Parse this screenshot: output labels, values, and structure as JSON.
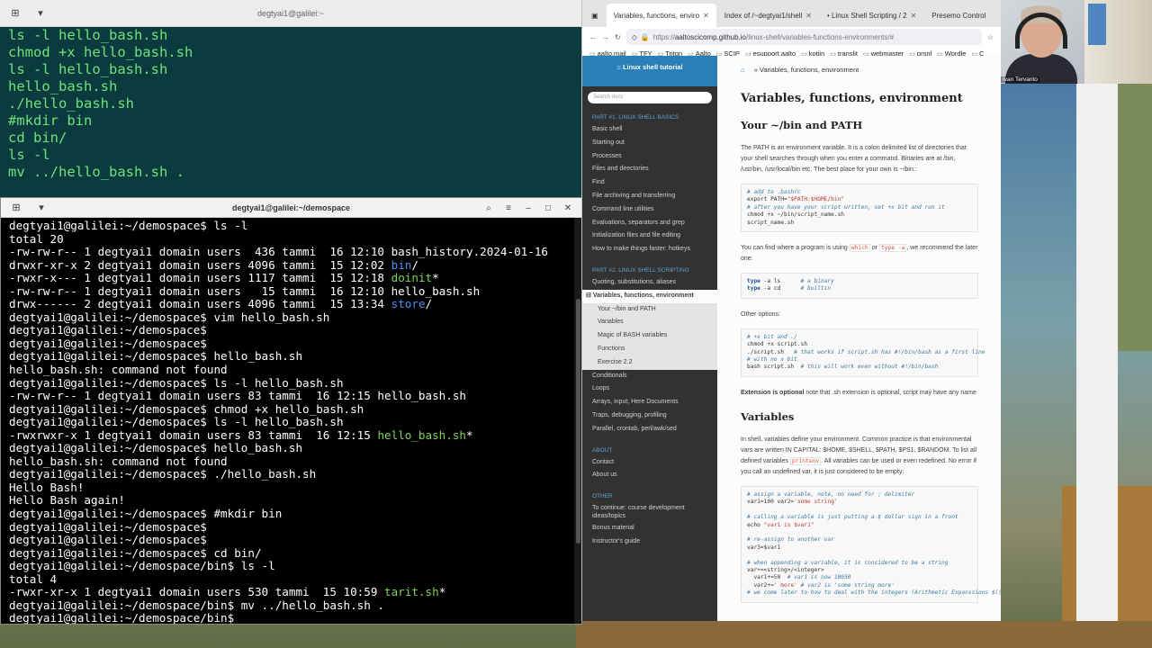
{
  "terminal_top": {
    "title": "degtyai1@galilei:~",
    "lines": [
      "ls -l hello_bash.sh",
      "chmod +x hello_bash.sh",
      "ls -l hello_bash.sh",
      "hello_bash.sh",
      "./hello_bash.sh",
      "#mkdir bin",
      "cd bin/",
      "ls -l",
      "mv ../hello_bash.sh ."
    ]
  },
  "terminal_bottom": {
    "title": "degtyai1@galilei:~/demospace",
    "lines": [
      [
        {
          "t": "degtyai1@galilei:~/demospace$ ls -l"
        }
      ],
      [
        {
          "t": "total 20"
        }
      ],
      [
        {
          "t": "-rw-rw-r-- 1 degtyai1 domain users  436 tammi  16 12:10 bash_history.2024-01-16"
        }
      ],
      [
        {
          "t": "drwxr-xr-x 2 degtyai1 domain users 4096 tammi  15 12:02 "
        },
        {
          "t": "bin",
          "c": "blue"
        },
        {
          "t": "/"
        }
      ],
      [
        {
          "t": "-rwxr-x--- 1 degtyai1 domain users 1117 tammi  15 12:18 "
        },
        {
          "t": "doinit",
          "c": "green"
        },
        {
          "t": "*"
        }
      ],
      [
        {
          "t": "-rw-rw-r-- 1 degtyai1 domain users   15 tammi  16 12:10 hello_bash.sh"
        }
      ],
      [
        {
          "t": "drwx------ 2 degtyai1 domain users 4096 tammi  15 13:34 "
        },
        {
          "t": "store",
          "c": "blue"
        },
        {
          "t": "/"
        }
      ],
      [
        {
          "t": "degtyai1@galilei:~/demospace$ vim hello_bash.sh"
        }
      ],
      [
        {
          "t": "degtyai1@galilei:~/demospace$"
        }
      ],
      [
        {
          "t": "degtyai1@galilei:~/demospace$"
        }
      ],
      [
        {
          "t": "degtyai1@galilei:~/demospace$ hello_bash.sh"
        }
      ],
      [
        {
          "t": "hello_bash.sh: command not found"
        }
      ],
      [
        {
          "t": "degtyai1@galilei:~/demospace$ ls -l hello_bash.sh"
        }
      ],
      [
        {
          "t": "-rw-rw-r-- 1 degtyai1 domain users 83 tammi  16 12:15 hello_bash.sh"
        }
      ],
      [
        {
          "t": "degtyai1@galilei:~/demospace$ chmod +x hello_bash.sh"
        }
      ],
      [
        {
          "t": "degtyai1@galilei:~/demospace$ ls -l hello_bash.sh"
        }
      ],
      [
        {
          "t": "-rwxrwxr-x 1 degtyai1 domain users 83 tammi  16 12:15 "
        },
        {
          "t": "hello_bash.sh",
          "c": "green"
        },
        {
          "t": "*"
        }
      ],
      [
        {
          "t": "degtyai1@galilei:~/demospace$ hello_bash.sh"
        }
      ],
      [
        {
          "t": "hello_bash.sh: command not found"
        }
      ],
      [
        {
          "t": "degtyai1@galilei:~/demospace$ ./hello_bash.sh"
        }
      ],
      [
        {
          "t": "Hello Bash!"
        }
      ],
      [
        {
          "t": "Hello Bash again!"
        }
      ],
      [
        {
          "t": "degtyai1@galilei:~/demospace$ #mkdir bin"
        }
      ],
      [
        {
          "t": "degtyai1@galilei:~/demospace$"
        }
      ],
      [
        {
          "t": "degtyai1@galilei:~/demospace$"
        }
      ],
      [
        {
          "t": "degtyai1@galilei:~/demospace$ cd bin/"
        }
      ],
      [
        {
          "t": "degtyai1@galilei:~/demospace/bin$ ls -l"
        }
      ],
      [
        {
          "t": "total 4"
        }
      ],
      [
        {
          "t": "-rwxr-xr-x 1 degtyai1 domain users 530 tammi  15 10:59 "
        },
        {
          "t": "tarit.sh",
          "c": "green"
        },
        {
          "t": "*"
        }
      ],
      [
        {
          "t": "degtyai1@galilei:~/demospace/bin$ mv ../hello_bash.sh ."
        }
      ],
      [
        {
          "t": "degtyai1@galilei:~/demospace/bin$"
        }
      ]
    ]
  },
  "browser": {
    "tabs": [
      {
        "label": "Variables, functions, enviro",
        "active": true
      },
      {
        "label": "Index of /~degtyai1/shell",
        "active": false
      },
      {
        "label": "• Linux Shell Scripting / 2",
        "active": false
      },
      {
        "label": "Presemo Control",
        "active": false
      }
    ],
    "url_prefix": "https://",
    "url_host": "aaltoscicomp.github.io",
    "url_path": "/linux-shell/variables-functions-environments/#",
    "bookmarks": [
      "aalto.mail",
      "TFY",
      "Triton",
      "Aalto",
      "SCIP",
      "esupport.aalto",
      "kotiin",
      "translit",
      "webmaster",
      "prsnl",
      "Wordle",
      "C"
    ],
    "sidebar": {
      "brand": "Linux shell tutorial",
      "search_placeholder": "Search docs",
      "part1": "PART #1. LINUX SHELL BASICS",
      "part1_items": [
        "Basic shell",
        "Starting out",
        "Processes",
        "Files and directories",
        "Find",
        "File archiving and transferring",
        "Command line utilities",
        "Evaluations, separators and grep",
        "Initialization files and file editing",
        "How to make things faster: hotkeys"
      ],
      "part2": "PART #2. LINUX SHELL SCRIPTING",
      "part2_items_before": [
        "Quoting, substitutions, aliases"
      ],
      "current": "Variables, functions, environment",
      "sub_items": [
        "Your ~/bin and PATH",
        "Variables",
        "Magic of BASH variables",
        "Functions",
        "Exercise 2.2"
      ],
      "part2_items_after": [
        "Conditionals",
        "Loops",
        "Arrays, input, Here Documents",
        "Traps, debugging, profiling",
        "Parallel, crontab, perl/awk/sed"
      ],
      "about": "ABOUT",
      "about_items": [
        "Contact",
        "About us"
      ],
      "other": "OTHER",
      "other_items": [
        "To continue: course development ideas/topics",
        "Bonus material",
        "Instructor's guide"
      ]
    },
    "content": {
      "breadcrumb": "Variables, functions, environment",
      "h1": "Variables, functions, environment",
      "h2_path": "Your ~/bin and PATH",
      "p_path": "The PATH is an environment variable. It is a colon delimited list of directories that your shell searches through when you enter a command. Binaries are at /bin, /usr/bin, /usr/local/bin etc. The best place for your own is ~/bin.:",
      "p_find_1": "You can find where a program is using",
      "code_which": "which",
      "p_find_or": "or",
      "code_typea": "type -a",
      "p_find_2": ", we recommend the later one:",
      "p_other": "Other options:",
      "p_ext_bold": "Extension is optional",
      "p_ext_rest": " note that .sh extension is optional, script may have any name",
      "h2_vars": "Variables",
      "p_vars_1": "In shell, variables define your environment. Common practice is that environmental vars are written IN CAPITAL: $HOME, $SHELL, $PATH, $PS1, $RANDOM. To list all defined variables",
      "code_printenv": "printenv",
      "p_vars_2": ". All variables can be used or even redefined. No error if you call an undefined var, it is just considered to be empty:"
    }
  },
  "webcam": {
    "name": "Ivan Tervanto"
  }
}
